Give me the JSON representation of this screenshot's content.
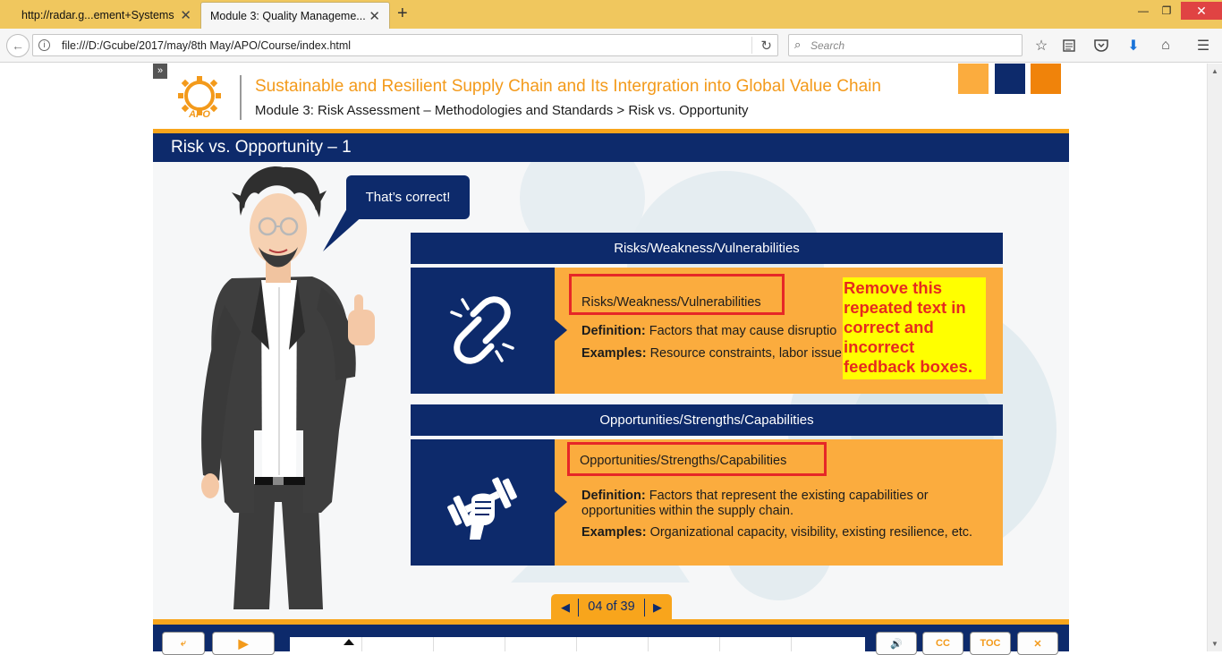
{
  "browser": {
    "tabs": [
      {
        "title": "http://radar.g...ement+Systems",
        "active": false
      },
      {
        "title": "Module 3: Quality Manageme...",
        "active": true
      }
    ],
    "url": "file:///D:/Gcube/2017/may/8th May/APO/Course/index.html",
    "search_placeholder": "Search"
  },
  "course": {
    "logo_text": "APO",
    "title": "Sustainable and Resilient Supply Chain and Its Intergration into Global Value Chain",
    "breadcrumb": "Module 3: Risk Assessment – Methodologies and Standards > Risk vs. Opportunity",
    "swatch_colors": [
      "#fbac3e",
      "#0d2a6b",
      "#f0830a"
    ]
  },
  "slide": {
    "title": "Risk vs. Opportunity – 1",
    "speech_bubble": "That’s correct!",
    "panels": [
      {
        "heading": "Risks/Weakness/Vulnerabilities",
        "icon": "broken-chain-icon",
        "repeated_label": "Risks/Weakness/Vulnerabilities",
        "definition_label": "Definition:",
        "definition_text": "Factors that may cause disruptio",
        "examples_label": "Examples:",
        "examples_text": "Resource constraints, labor issue"
      },
      {
        "heading": "Opportunities/Strengths/Capabilities",
        "icon": "fist-dumbbell-icon",
        "repeated_label": "Opportunities/Strengths/Capabilities",
        "definition_label": "Definition:",
        "definition_text": "Factors that represent the existing capabilities or",
        "definition_text_2": "opportunities within the supply chain.",
        "examples_label": "Examples:",
        "examples_text": "Organizational capacity, visibility, existing resilience, etc."
      }
    ],
    "review_note": "Remove this repeated text in correct and incorrect feedback boxes.",
    "pager": {
      "text": "04 of 39"
    }
  },
  "footer": {
    "buttons": [
      {
        "name": "exit",
        "label": "⤶"
      },
      {
        "name": "play",
        "label": "▶"
      },
      {
        "name": "audio",
        "label": "🔊"
      },
      {
        "name": "cc",
        "label": "CC"
      },
      {
        "name": "toc",
        "label": "TOC"
      },
      {
        "name": "close",
        "label": "✕"
      }
    ]
  },
  "colors": {
    "brand_navy": "#0d2a6b",
    "brand_orange": "#f8a51c",
    "panel_orange": "#fbac3e",
    "highlight_red": "#e62727",
    "note_yellow": "#ffff00"
  }
}
